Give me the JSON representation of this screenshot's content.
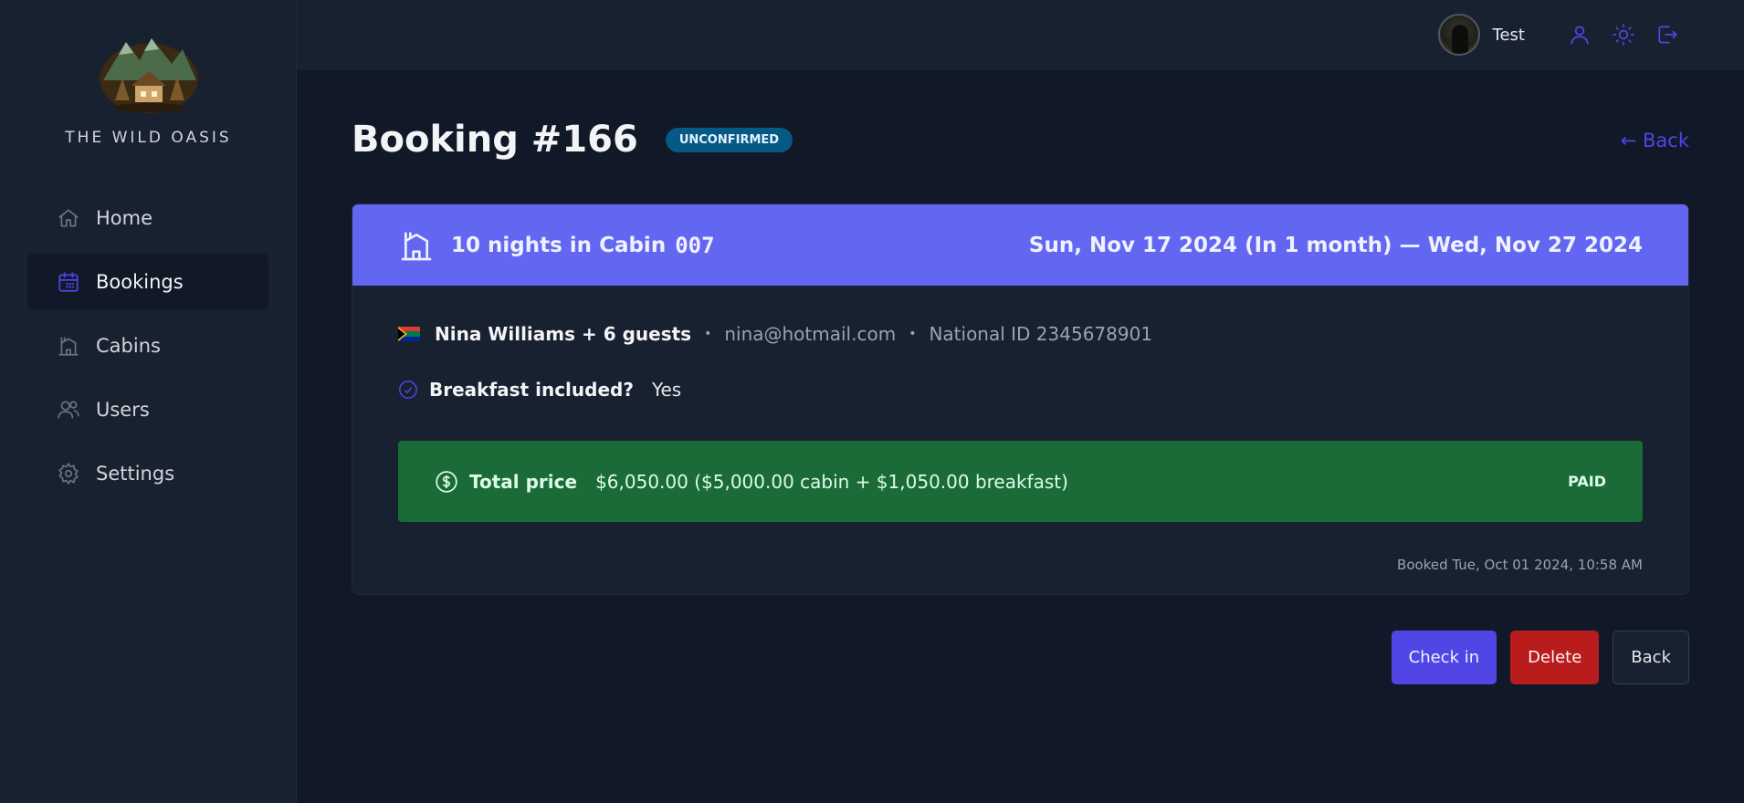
{
  "brand": {
    "name": "THE WILD OASIS"
  },
  "sidebar": {
    "items": [
      {
        "label": "Home",
        "icon": "home-icon"
      },
      {
        "label": "Bookings",
        "icon": "calendar-icon",
        "active": true
      },
      {
        "label": "Cabins",
        "icon": "cabin-icon"
      },
      {
        "label": "Users",
        "icon": "users-icon"
      },
      {
        "label": "Settings",
        "icon": "gear-icon"
      }
    ]
  },
  "header": {
    "username": "Test",
    "icons": [
      "user-icon",
      "sun-icon",
      "logout-icon"
    ]
  },
  "booking": {
    "title": "Booking #166",
    "status": "unconfirmed",
    "back_link": "← Back",
    "nights_text": "10 nights in Cabin",
    "cabin_number": "007",
    "dates": "Sun, Nov 17 2024 (In 1 month) — Wed, Nov 27 2024",
    "guest": {
      "name": "Nina Williams + 6 guests",
      "email": "nina@hotmail.com",
      "national_id": "National ID 2345678901",
      "flag": "south-africa-flag-icon"
    },
    "breakfast": {
      "label": "Breakfast included?",
      "value": "Yes"
    },
    "price": {
      "label": "Total price",
      "value": "$6,050.00 ($5,000.00 cabin + $1,050.00 breakfast)",
      "status": "Paid"
    },
    "booked_at": "Booked Tue, Oct 01 2024, 10:58 AM"
  },
  "actions": {
    "check_in": "Check in",
    "delete": "Delete",
    "back": "Back"
  },
  "colors": {
    "accent": "#4f46e5",
    "header_band": "#6366f1",
    "paid_bg": "#1a6b37",
    "danger": "#b91c1c",
    "status_tag": "#075985"
  }
}
